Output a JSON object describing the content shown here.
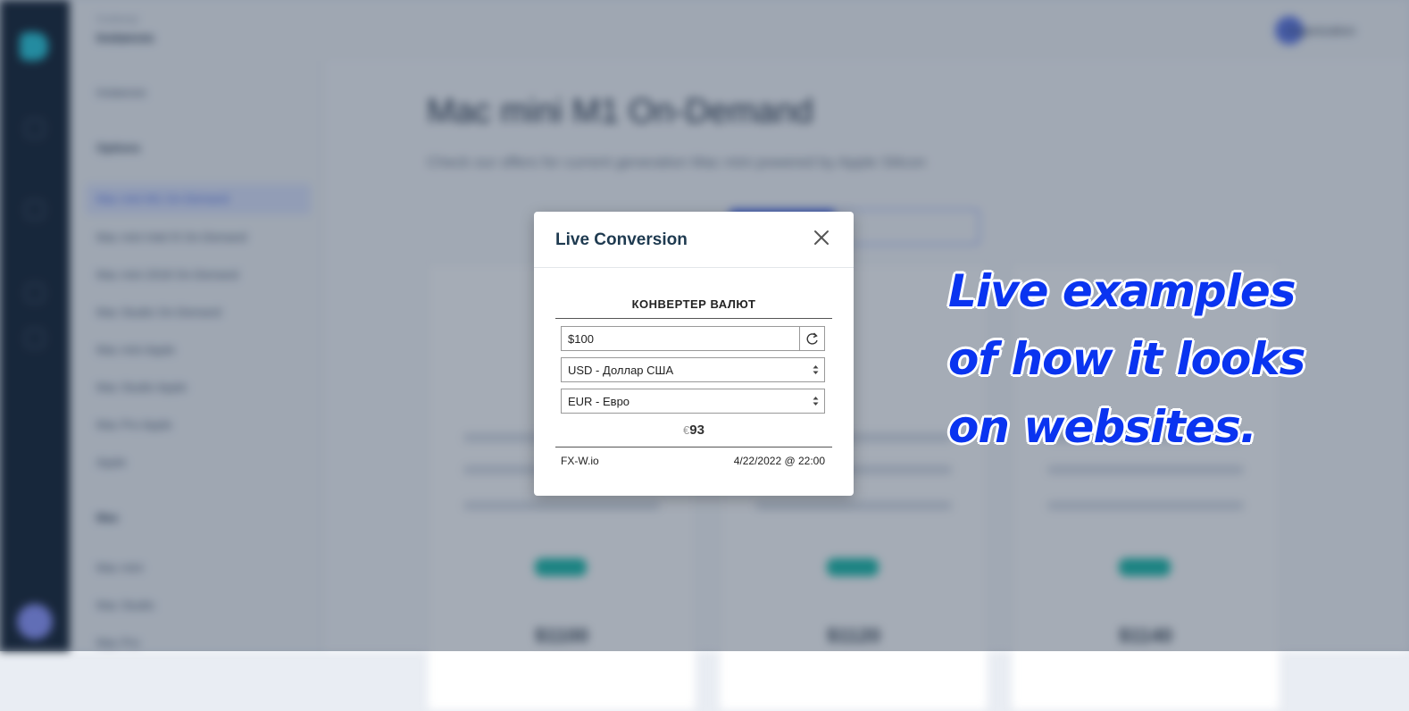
{
  "background": {
    "breadcrumb": "Scaleway",
    "breadcrumb_title": "Instances",
    "user_name": "Organization",
    "sidebar": {
      "top_item": "Instances",
      "section1": "Options",
      "items": [
        "Mac mini M1 On-Demand",
        "Mac mini Intel i5 On-Demand",
        "Mac mini 2018 On-Demand",
        "Mac Studio On-Demand",
        "Mac mini Apple",
        "Mac Studio Apple",
        "Mac Pro Apple",
        "Apple"
      ],
      "section2": "Mac",
      "items2": [
        "Mac mini",
        "Mac Studio",
        "Mac Pro"
      ]
    },
    "page_title": "Mac mini M1 On-Demand",
    "page_subtitle": "Check our offers for current generation Mac mini powered by Apple Silicon",
    "prices": [
      "$1100",
      "$1120",
      "$1140"
    ]
  },
  "modal": {
    "title": "Live Conversion",
    "widget": {
      "title": "КОНВЕРТЕР ВАЛЮТ",
      "amount": "$100",
      "from_currency": "USD - Доллар США",
      "to_currency": "EUR - Евро",
      "result_symbol": "€",
      "result_value": "93",
      "source": "FX-W.io",
      "timestamp": "4/22/2022 @ 22:00"
    }
  },
  "promo": {
    "line1": "Live examples",
    "line2": "of how it looks",
    "line3": "on websites."
  },
  "colors": {
    "promo_text": "#0a34f0",
    "accent": "#4a6cf0",
    "teal": "#12b9a6"
  }
}
